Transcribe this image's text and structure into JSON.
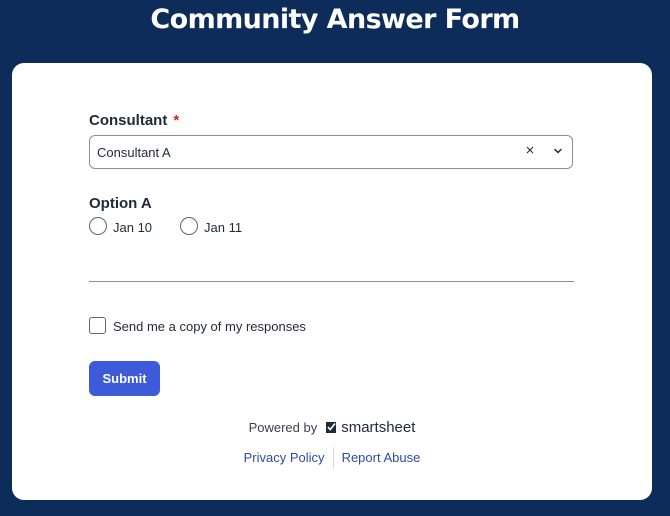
{
  "header": {
    "title": "Community Answer Form"
  },
  "form": {
    "consultant": {
      "label": "Consultant",
      "required_mark": "*",
      "value": "Consultant A",
      "clear_glyph": "×"
    },
    "option_a": {
      "label": "Option A",
      "options": [
        "Jan 10",
        "Jan 11"
      ]
    },
    "copy_checkbox": {
      "label": "Send me a copy of my responses",
      "checked": false
    },
    "submit_label": "Submit"
  },
  "footer": {
    "powered_by": "Powered by",
    "brand": "smartsheet",
    "links": [
      "Privacy Policy",
      "Report Abuse"
    ]
  },
  "colors": {
    "page_background": "#0d2c59",
    "submit_button": "#3d5bd9",
    "required": "#d0271d",
    "link": "#2f4aa8"
  }
}
